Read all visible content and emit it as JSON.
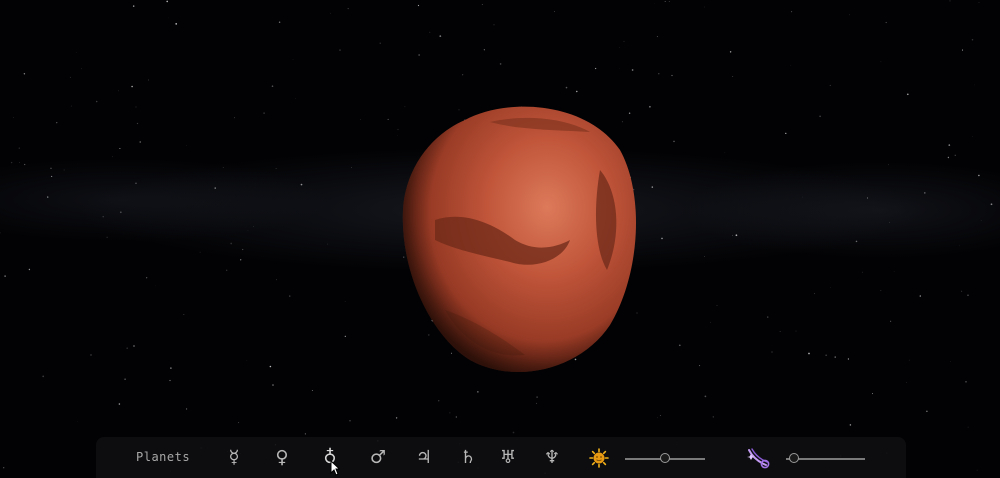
{
  "toolbar": {
    "label": "Planets",
    "planets": [
      {
        "name": "mercury",
        "symbol": "☿"
      },
      {
        "name": "venus",
        "symbol": "♀"
      },
      {
        "name": "earth",
        "symbol": "♁"
      },
      {
        "name": "mars",
        "symbol": "♂"
      },
      {
        "name": "jupiter",
        "symbol": "♃"
      },
      {
        "name": "saturn",
        "symbol": "♄"
      },
      {
        "name": "uranus",
        "symbol": "♅"
      },
      {
        "name": "neptune",
        "symbol": "♆"
      }
    ],
    "active_planet": "mars",
    "sun_icon": "sun-icon",
    "comet_icon": "comet-icon",
    "sun_slider_value": 0.5,
    "comet_slider_value": 0.1
  },
  "colors": {
    "planet_base": "#b4482b",
    "planet_dark": "#5a1e10",
    "sun": "#f2b21a",
    "comet": "#9f6de0"
  }
}
